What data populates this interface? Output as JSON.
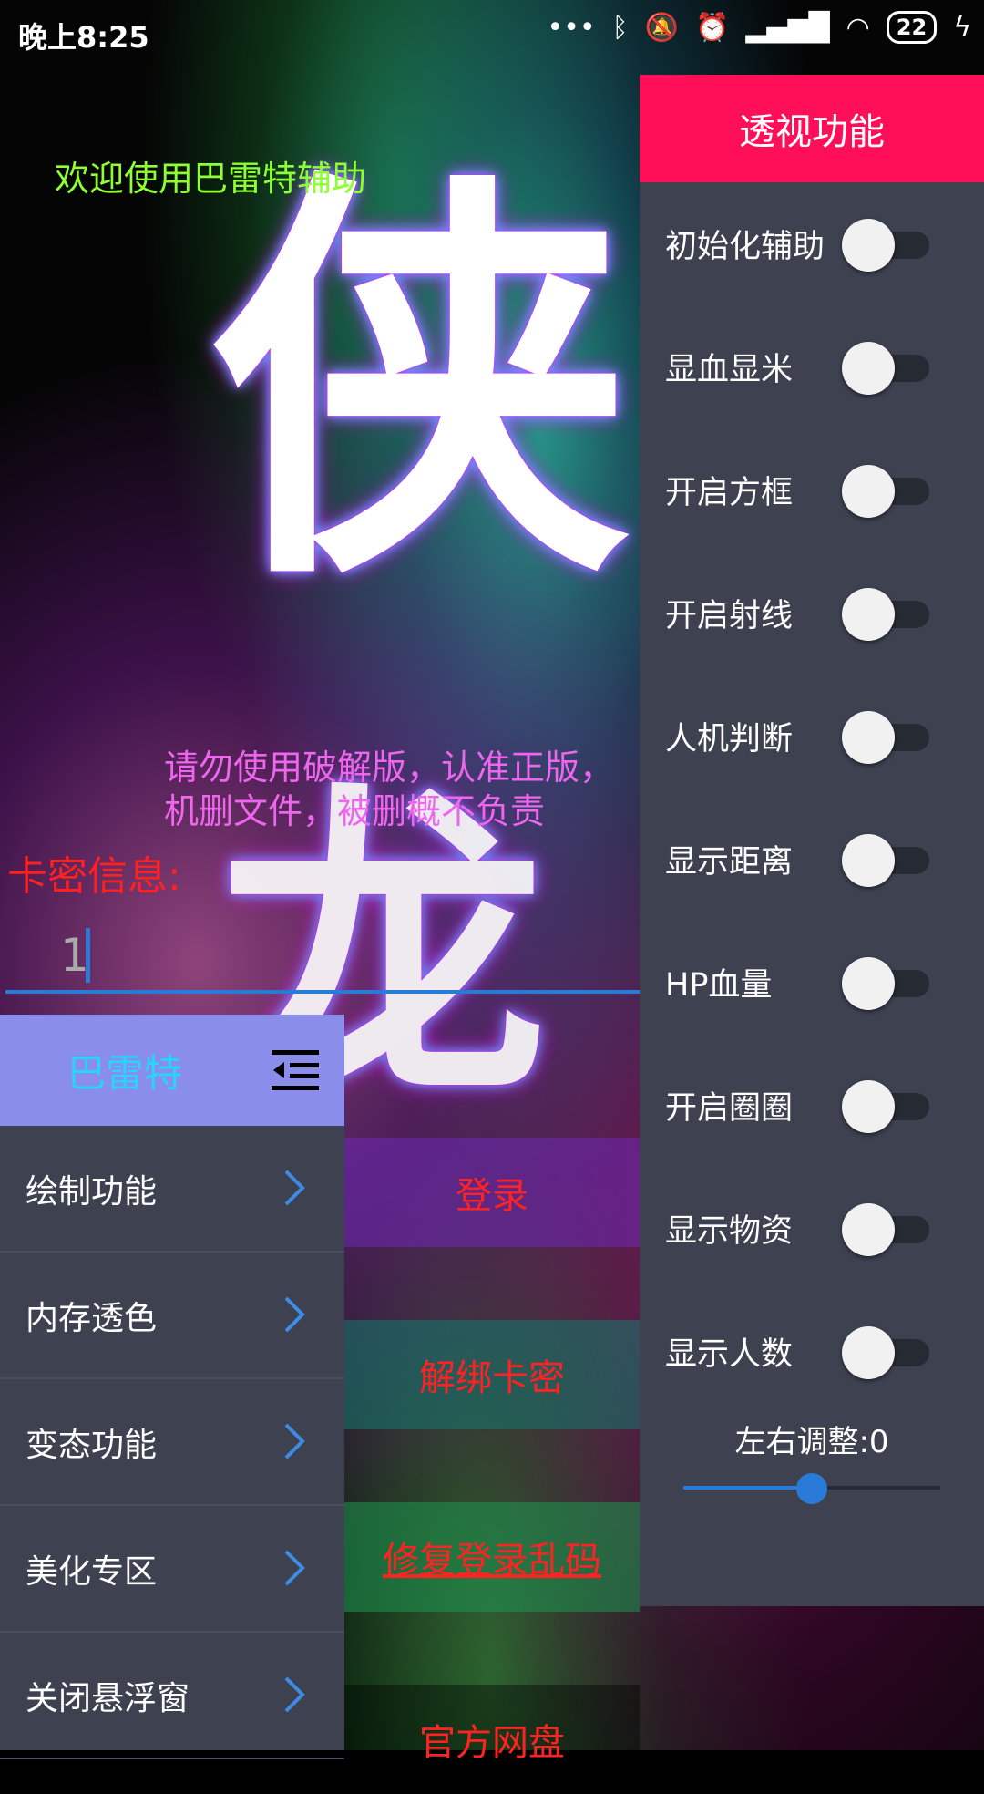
{
  "status_bar": {
    "time": "晚上8:25",
    "icons": [
      "more-dots-icon",
      "bluetooth-icon",
      "mute-bell-icon",
      "alarm-icon",
      "signal-icon",
      "wifi-icon",
      "battery-icon",
      "charging-icon"
    ],
    "battery": "22"
  },
  "background_text": {
    "glyph1": "侠",
    "glyph2": "龙"
  },
  "welcome_text": "欢迎使用巴雷特辅助",
  "warning_text": "请勿使用破解版，认准正版，机删文件，被删概不负责",
  "card": {
    "label": "卡密信息:",
    "value": "1"
  },
  "actions": {
    "login": "登录",
    "unbind": "解绑卡密",
    "fix_login": "修复登录乱码",
    "netdisk": "官方网盘"
  },
  "left_menu": {
    "title": "巴雷特",
    "items": [
      {
        "label": "绘制功能"
      },
      {
        "label": "内存透色"
      },
      {
        "label": "变态功能"
      },
      {
        "label": "美化专区"
      },
      {
        "label": "关闭悬浮窗"
      }
    ]
  },
  "right_panel": {
    "title": "透视功能",
    "toggles": [
      {
        "label": "初始化辅助",
        "on": false
      },
      {
        "label": "显血显米",
        "on": false
      },
      {
        "label": "开启方框",
        "on": false
      },
      {
        "label": "开启射线",
        "on": false
      },
      {
        "label": "人机判断",
        "on": false
      },
      {
        "label": "显示距离",
        "on": false
      },
      {
        "label": "HP血量",
        "on": false
      },
      {
        "label": "开启圈圈",
        "on": false
      },
      {
        "label": "显示物资",
        "on": false
      },
      {
        "label": "显示人数",
        "on": false
      }
    ],
    "adjust_label": "左右调整:0",
    "slider_fraction": 0.5
  },
  "colors": {
    "panel_bg": "#3d4150",
    "right_header": "#fe0f58",
    "left_header": "#8a8eea",
    "accent_blue": "#2a7bd8",
    "welcome_green": "#8dff33",
    "warning_pink": "#ee66ee",
    "card_red": "#ff2020"
  }
}
